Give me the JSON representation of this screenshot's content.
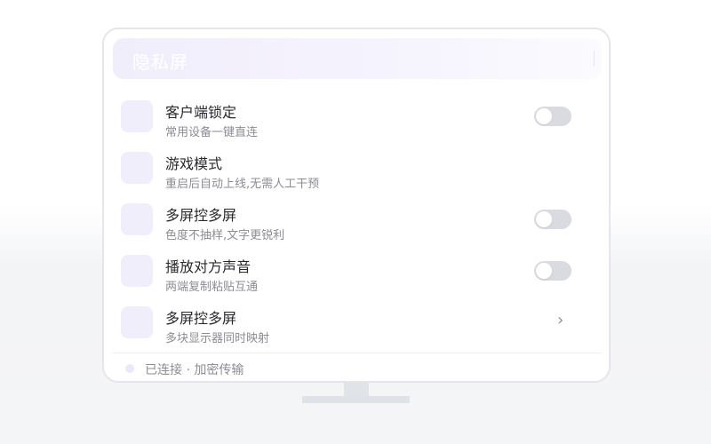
{
  "header": {
    "title": "隐私屏"
  },
  "settings": [
    {
      "title": "客户端锁定",
      "subtitle": "常用设备一键直连",
      "control": "toggle",
      "enabled": false
    },
    {
      "title": "游戏模式",
      "subtitle": "重启后自动上线,无需人工干预",
      "control": "none"
    },
    {
      "title": "多屏控多屏",
      "subtitle": "色度不抽样,文字更锐利",
      "control": "toggle",
      "enabled": false
    },
    {
      "title": "播放对方声音",
      "subtitle": "两端复制粘贴互通",
      "control": "toggle",
      "enabled": false
    },
    {
      "title": "多屏控多屏",
      "subtitle": "多块显示器同时映射",
      "control": "chevron",
      "chevron": "›"
    }
  ],
  "status": {
    "text": "已连接 · 加密传输"
  },
  "colors": {
    "accent_light": "#f1eefc",
    "toggle_off": "#d9dbe1",
    "text_primary": "#2a2a2e",
    "text_secondary": "#8c8c94"
  },
  "icons": {
    "row_icon": "feature-icon-placeholder",
    "status": "status-dot-icon",
    "chevron": "chevron-right-icon"
  }
}
